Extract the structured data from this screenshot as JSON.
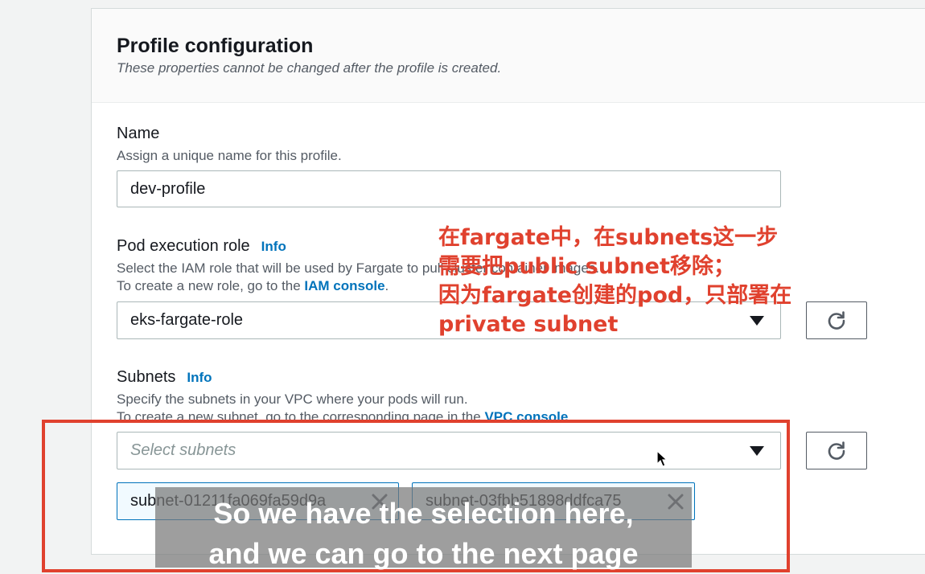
{
  "profile": {
    "title": "Profile configuration",
    "subtitle": "These properties cannot be changed after the profile is created."
  },
  "name_field": {
    "label": "Name",
    "description": "Assign a unique name for this profile.",
    "value": "dev-profile"
  },
  "pod_role": {
    "label": "Pod execution role",
    "info": "Info",
    "description_line1": "Select the IAM role that will be used by Fargate to pull cluster container images.",
    "description_line2_prefix": "To create a new role, go to the ",
    "description_line2_link": "IAM console",
    "description_line2_suffix": ".",
    "value": "eks-fargate-role"
  },
  "subnets": {
    "label": "Subnets",
    "info": "Info",
    "description_line1": "Specify the subnets in your VPC where your pods will run.",
    "description_line2_prefix": "To create a new subnet, go to the corresponding page in the ",
    "description_line2_link": "VPC console",
    "description_line2_suffix": ".",
    "placeholder": "Select subnets",
    "tokens": [
      "subnet-01211fa069fa59d9a",
      "subnet-03fbb51898ddfca75"
    ]
  },
  "annotation": {
    "text": "在fargate中，在subnets这一步\n需要把public subnet移除；\n因为fargate创建的pod，只部署在\nprivate subnet"
  },
  "video_caption": {
    "line1": "So we have the selection here,",
    "line2": "and we can go to the next page"
  },
  "colors": {
    "accent": "#0073bb",
    "annotation": "#e0412e"
  }
}
